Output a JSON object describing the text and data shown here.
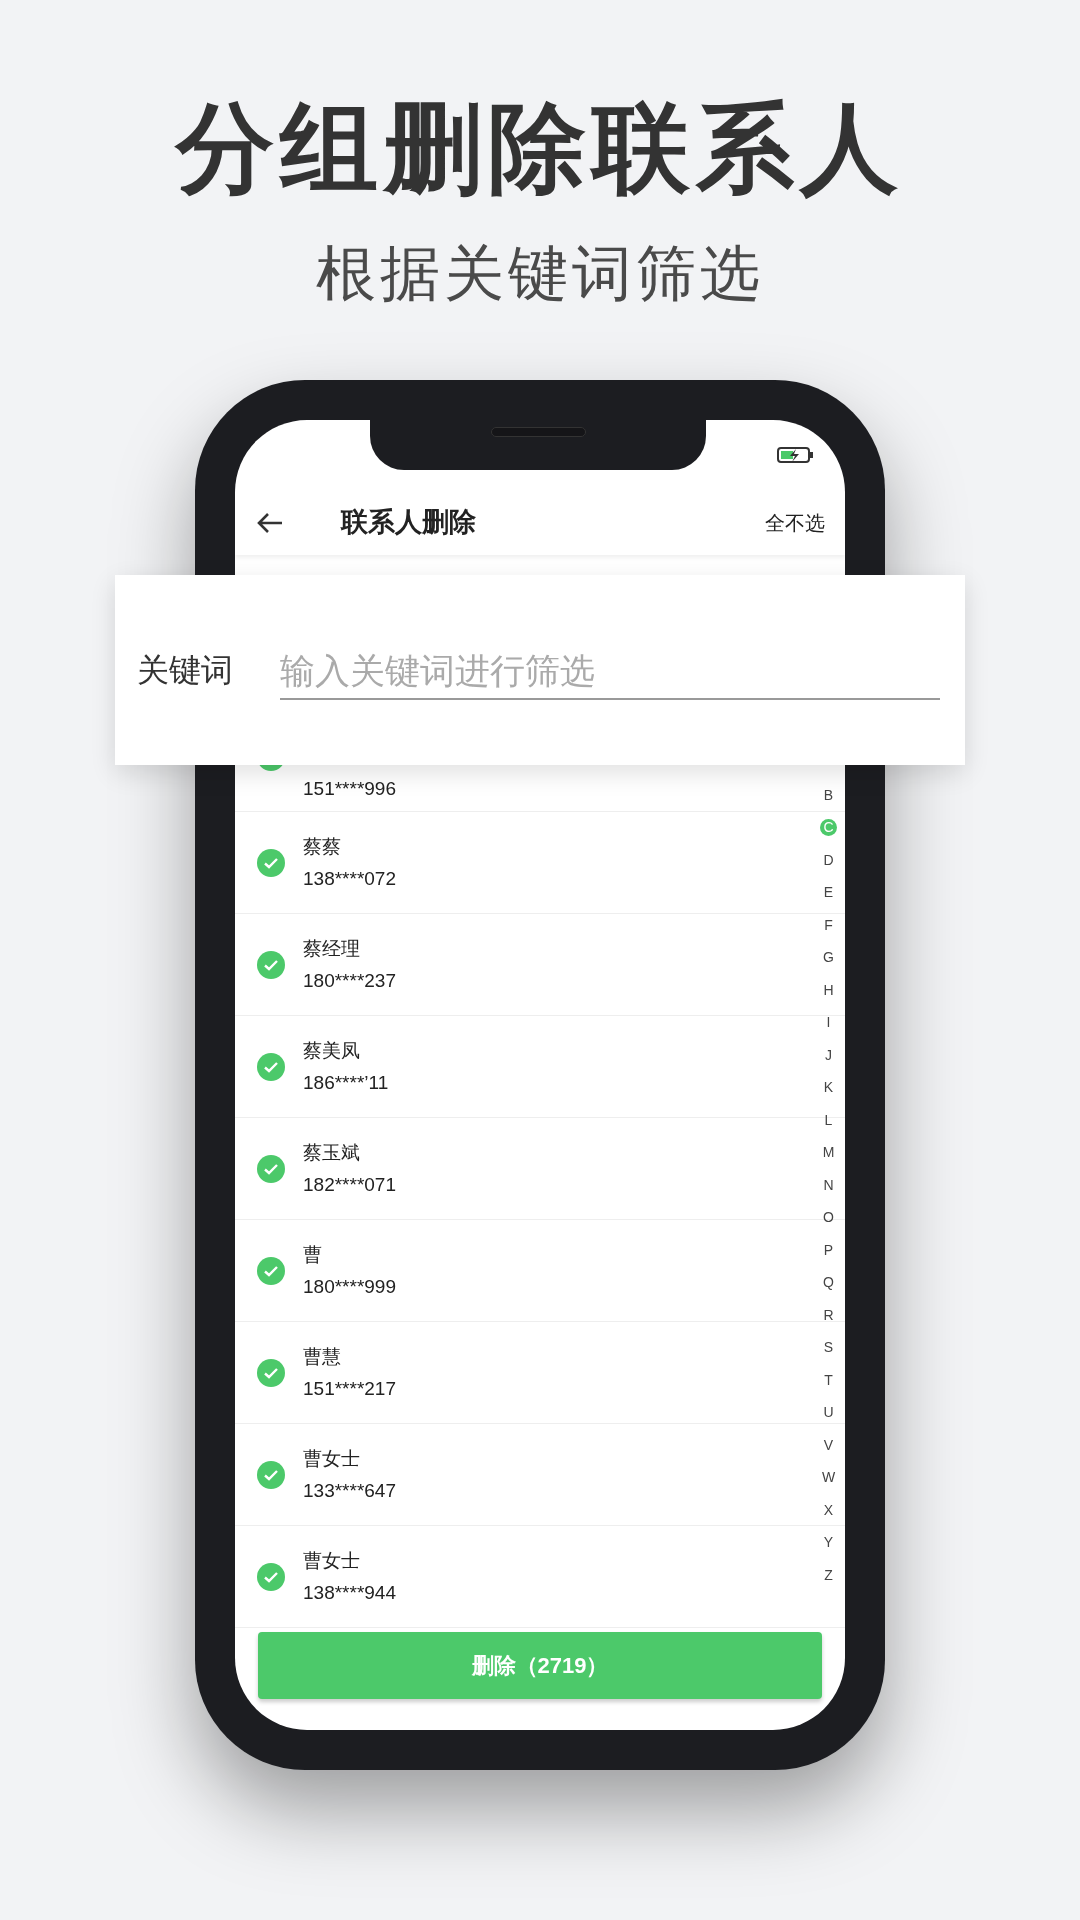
{
  "headline": "分组删除联系人",
  "subtitle": "根据关键词筛选",
  "app_bar": {
    "title": "联系人删除",
    "action": "全不选"
  },
  "filter": {
    "label": "关键词",
    "placeholder": "输入关键词进行筛选"
  },
  "contacts": [
    {
      "phone": "151****996",
      "checked": true
    },
    {
      "name": "蔡蔡",
      "phone": "138****072",
      "checked": true
    },
    {
      "name": "蔡经理",
      "phone": "180****237",
      "checked": true
    },
    {
      "name": "蔡美凤",
      "phone": "186****’11",
      "checked": true
    },
    {
      "name": "蔡玉斌",
      "phone": "182****071",
      "checked": true
    },
    {
      "name": "曹",
      "phone": "180****999",
      "checked": true
    },
    {
      "name": "曹慧",
      "phone": "151****217",
      "checked": true
    },
    {
      "name": "曹女士",
      "phone": "133****647",
      "checked": true
    },
    {
      "name": "曹女士",
      "phone": "138****944",
      "checked": true
    }
  ],
  "index": [
    {
      "letter": "B",
      "selected": false
    },
    {
      "letter": "C",
      "selected": true
    },
    {
      "letter": "D",
      "selected": false
    },
    {
      "letter": "E",
      "selected": false
    },
    {
      "letter": "F",
      "selected": false
    },
    {
      "letter": "G",
      "selected": false
    },
    {
      "letter": "H",
      "selected": false
    },
    {
      "letter": "I",
      "selected": false
    },
    {
      "letter": "J",
      "selected": false
    },
    {
      "letter": "K",
      "selected": false
    },
    {
      "letter": "L",
      "selected": false
    },
    {
      "letter": "M",
      "selected": false
    },
    {
      "letter": "N",
      "selected": false
    },
    {
      "letter": "O",
      "selected": false
    },
    {
      "letter": "P",
      "selected": false
    },
    {
      "letter": "Q",
      "selected": false
    },
    {
      "letter": "R",
      "selected": false
    },
    {
      "letter": "S",
      "selected": false
    },
    {
      "letter": "T",
      "selected": false
    },
    {
      "letter": "U",
      "selected": false
    },
    {
      "letter": "V",
      "selected": false
    },
    {
      "letter": "W",
      "selected": false
    },
    {
      "letter": "X",
      "selected": false
    },
    {
      "letter": "Y",
      "selected": false
    },
    {
      "letter": "Z",
      "selected": false
    }
  ],
  "delete_button": "删除（2719）"
}
